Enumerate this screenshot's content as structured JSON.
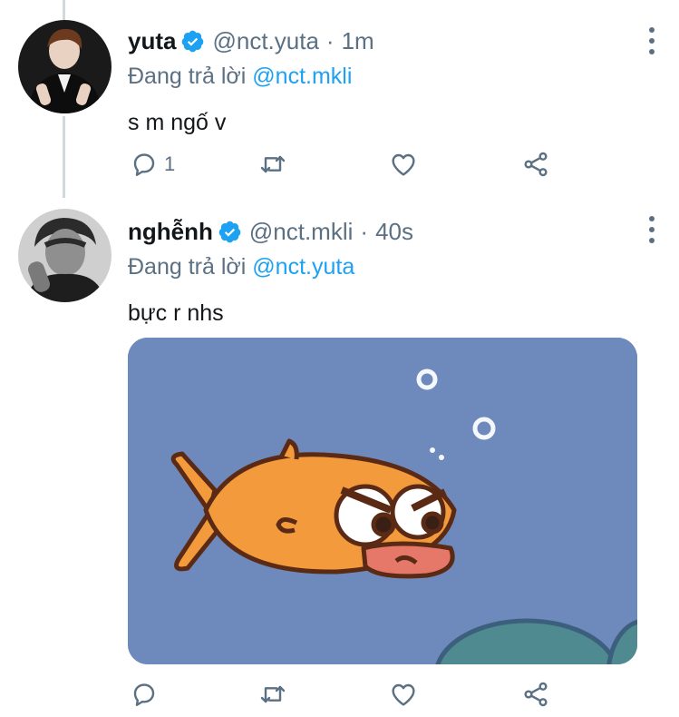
{
  "tweets": [
    {
      "name": "yuta",
      "handle": "@nct.yuta",
      "separator": "·",
      "time": "1m",
      "reply_prefix": "Đang trả lời",
      "reply_to": "@nct.mkli",
      "text": "s m ngố v",
      "reply_count": "1"
    },
    {
      "name": "nghễnh",
      "handle": "@nct.mkli",
      "separator": "·",
      "time": "40s",
      "reply_prefix": "Đang trả lời",
      "reply_to": "@nct.yuta",
      "text": "bực r nhs",
      "media": "angry-fish-sticker"
    }
  ],
  "colors": {
    "accent": "#1da1f2",
    "secondary_text": "#5b7083",
    "primary_text": "#14171a",
    "media_background": "#6a86b8",
    "fish": "#f39a3c"
  },
  "icons": [
    "verified-badge-icon",
    "more-vertical-icon",
    "reply-icon",
    "retweet-icon",
    "like-icon",
    "share-icon"
  ]
}
